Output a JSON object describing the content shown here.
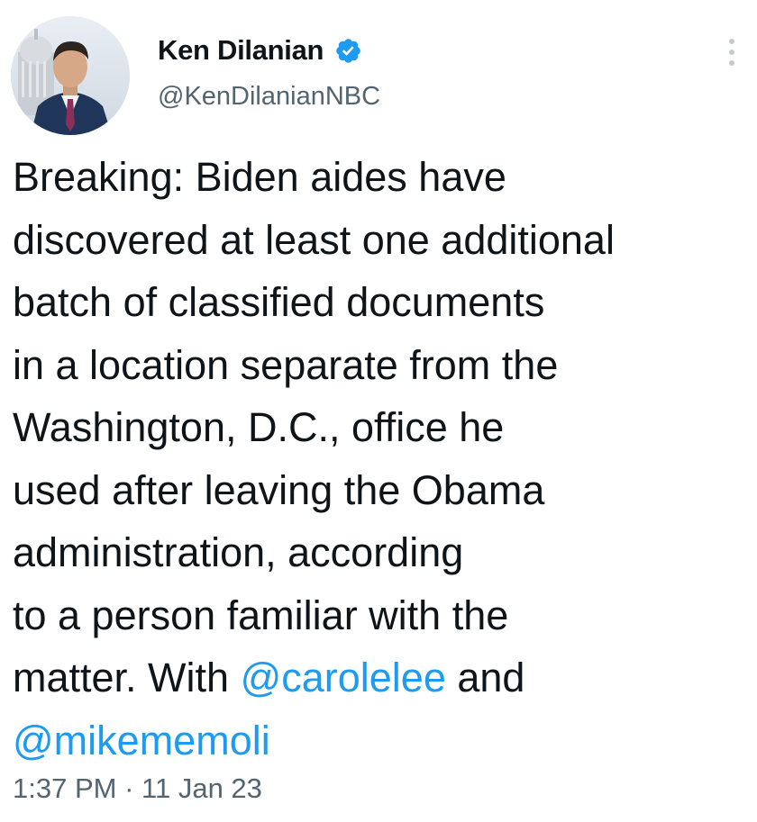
{
  "author": {
    "display_name": "Ken Dilanian",
    "handle": "@KenDilanianNBC",
    "verified": true,
    "avatar_icon": "profile-photo"
  },
  "tweet": {
    "lines": [
      "Breaking: Biden aides have",
      "discovered at least one additional",
      "batch of classified documents",
      "in a location separate from the",
      "Washington, D.C., office he",
      "used after leaving the Obama",
      "administration, according",
      "to a person familiar with the"
    ],
    "line9_text": "matter. With ",
    "mention1": "@carolelee",
    "line9_tail": " and",
    "mention2": "@mikememoli"
  },
  "meta": {
    "time": "1:37 PM",
    "separator": "·",
    "date": "11 Jan 23"
  },
  "colors": {
    "link": "#1d9bf0",
    "verified": "#1d9bf0",
    "secondary_text": "#536471",
    "primary_text": "#0f1419"
  }
}
